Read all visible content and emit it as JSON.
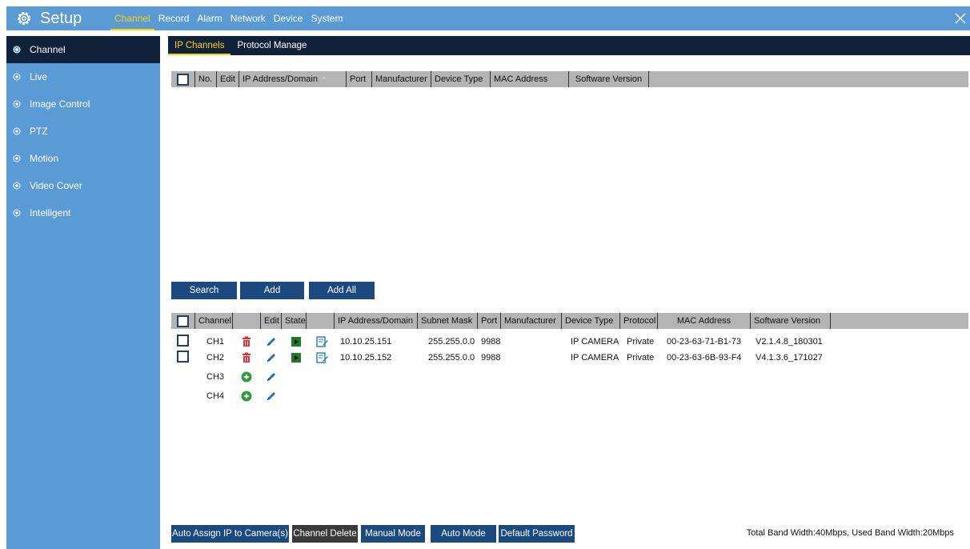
{
  "header": {
    "title": "Setup",
    "tabs": [
      "Channel",
      "Record",
      "Alarm",
      "Network",
      "Device",
      "System"
    ],
    "active_tab": "Channel"
  },
  "sidebar": {
    "items": [
      "Channel",
      "Live",
      "Image Control",
      "PTZ",
      "Motion",
      "Video Cover",
      "Intelligent"
    ],
    "active": "Channel"
  },
  "subtabs": {
    "items": [
      "IP Channels",
      "Protocol Manage"
    ],
    "active": "IP Channels"
  },
  "search_table": {
    "columns": [
      "No.",
      "Edit",
      "IP Address/Domain",
      "Port",
      "Manufacturer",
      "Device Type",
      "MAC Address",
      "Software Version"
    ],
    "sort_indicator": "^"
  },
  "search_buttons": {
    "search": "Search",
    "add": "Add",
    "add_all": "Add All"
  },
  "channel_table": {
    "columns": [
      "Channel",
      "",
      "Edit",
      "State",
      "",
      "IP Address/Domain",
      "Subnet Mask",
      "Port",
      "Manufacturer",
      "Device Type",
      "Protocol",
      "MAC Address",
      "Software Version"
    ],
    "rows": [
      {
        "checkbox": true,
        "channel": "CH1",
        "action": "delete",
        "state": "connected",
        "ip": "10.10.25.151",
        "subnet": "255.255.0.0",
        "port": "9988",
        "manufacturer": "",
        "device_type": "IP CAMERA",
        "protocol": "Private",
        "mac": "00-23-63-71-B1-73",
        "software": "V2.1.4.8_180301"
      },
      {
        "checkbox": true,
        "channel": "CH2",
        "action": "delete",
        "state": "connected",
        "ip": "10.10.25.152",
        "subnet": "255.255.0.0",
        "port": "9988",
        "manufacturer": "",
        "device_type": "IP CAMERA",
        "protocol": "Private",
        "mac": "00-23-63-6B-93-F4",
        "software": "V4.1.3.6_171027"
      },
      {
        "checkbox": false,
        "channel": "CH3",
        "action": "add",
        "state": "",
        "ip": "",
        "subnet": "",
        "port": "",
        "manufacturer": "",
        "device_type": "",
        "protocol": "",
        "mac": "",
        "software": ""
      },
      {
        "checkbox": false,
        "channel": "CH4",
        "action": "add",
        "state": "",
        "ip": "",
        "subnet": "",
        "port": "",
        "manufacturer": "",
        "device_type": "",
        "protocol": "",
        "mac": "",
        "software": ""
      }
    ]
  },
  "bottom_buttons": {
    "auto_assign": "Auto Assign IP to Camera(s)",
    "channel_delete": "Channel Delete",
    "manual_mode": "Manual Mode",
    "auto_mode": "Auto Mode",
    "default_password": "Default Password"
  },
  "bandwidth": "Total Band Width:40Mbps, Used Band Width:20Mbps",
  "colors": {
    "sidebar": "#5b9bd5",
    "dark_navy": "#10223a",
    "button": "#1a4a80",
    "active_tab": "#ffd200",
    "header_gray": "#b4b4b4"
  }
}
